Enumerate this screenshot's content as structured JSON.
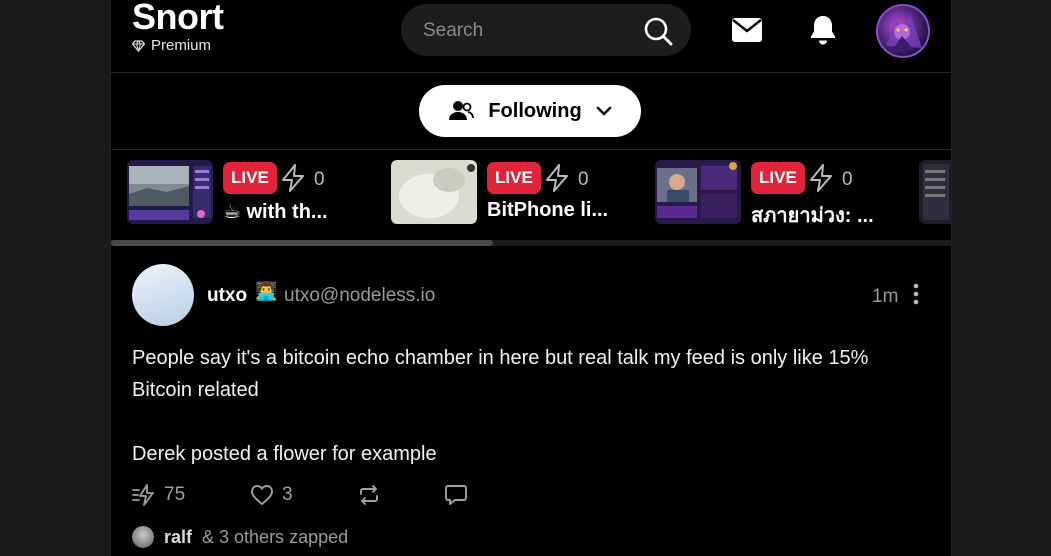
{
  "header": {
    "logo_title": "Snort",
    "logo_subtitle": "Premium",
    "search_placeholder": "Search",
    "icons": [
      "diamond-icon",
      "search-icon",
      "mail-icon",
      "bell-icon"
    ]
  },
  "feed_selector": {
    "label": "Following"
  },
  "live_streams": [
    {
      "badge": "LIVE",
      "zaps": "0",
      "title": "☕ with th..."
    },
    {
      "badge": "LIVE",
      "zaps": "0",
      "title": "BitPhone li..."
    },
    {
      "badge": "LIVE",
      "zaps": "0",
      "title": "สภายาม่วง: ..."
    }
  ],
  "post": {
    "author_name": "utxo",
    "author_badge": "👨‍💻",
    "author_nip05": "utxo@nodeless.io",
    "time": "1m",
    "text_line1": "People say it's a bitcoin echo chamber in here but real talk my feed is only like 15% Bitcoin related",
    "text_line2": "Derek posted a flower for example",
    "actions": {
      "zaps": "75",
      "likes": "3",
      "reposts": "",
      "replies": ""
    },
    "zapped_by_name": "ralf",
    "zapped_by_rest": "& 3 others zapped"
  },
  "colors": {
    "live_badge": "#e0243a",
    "background": "#000000",
    "accent_ring": "#8a4fc8"
  }
}
